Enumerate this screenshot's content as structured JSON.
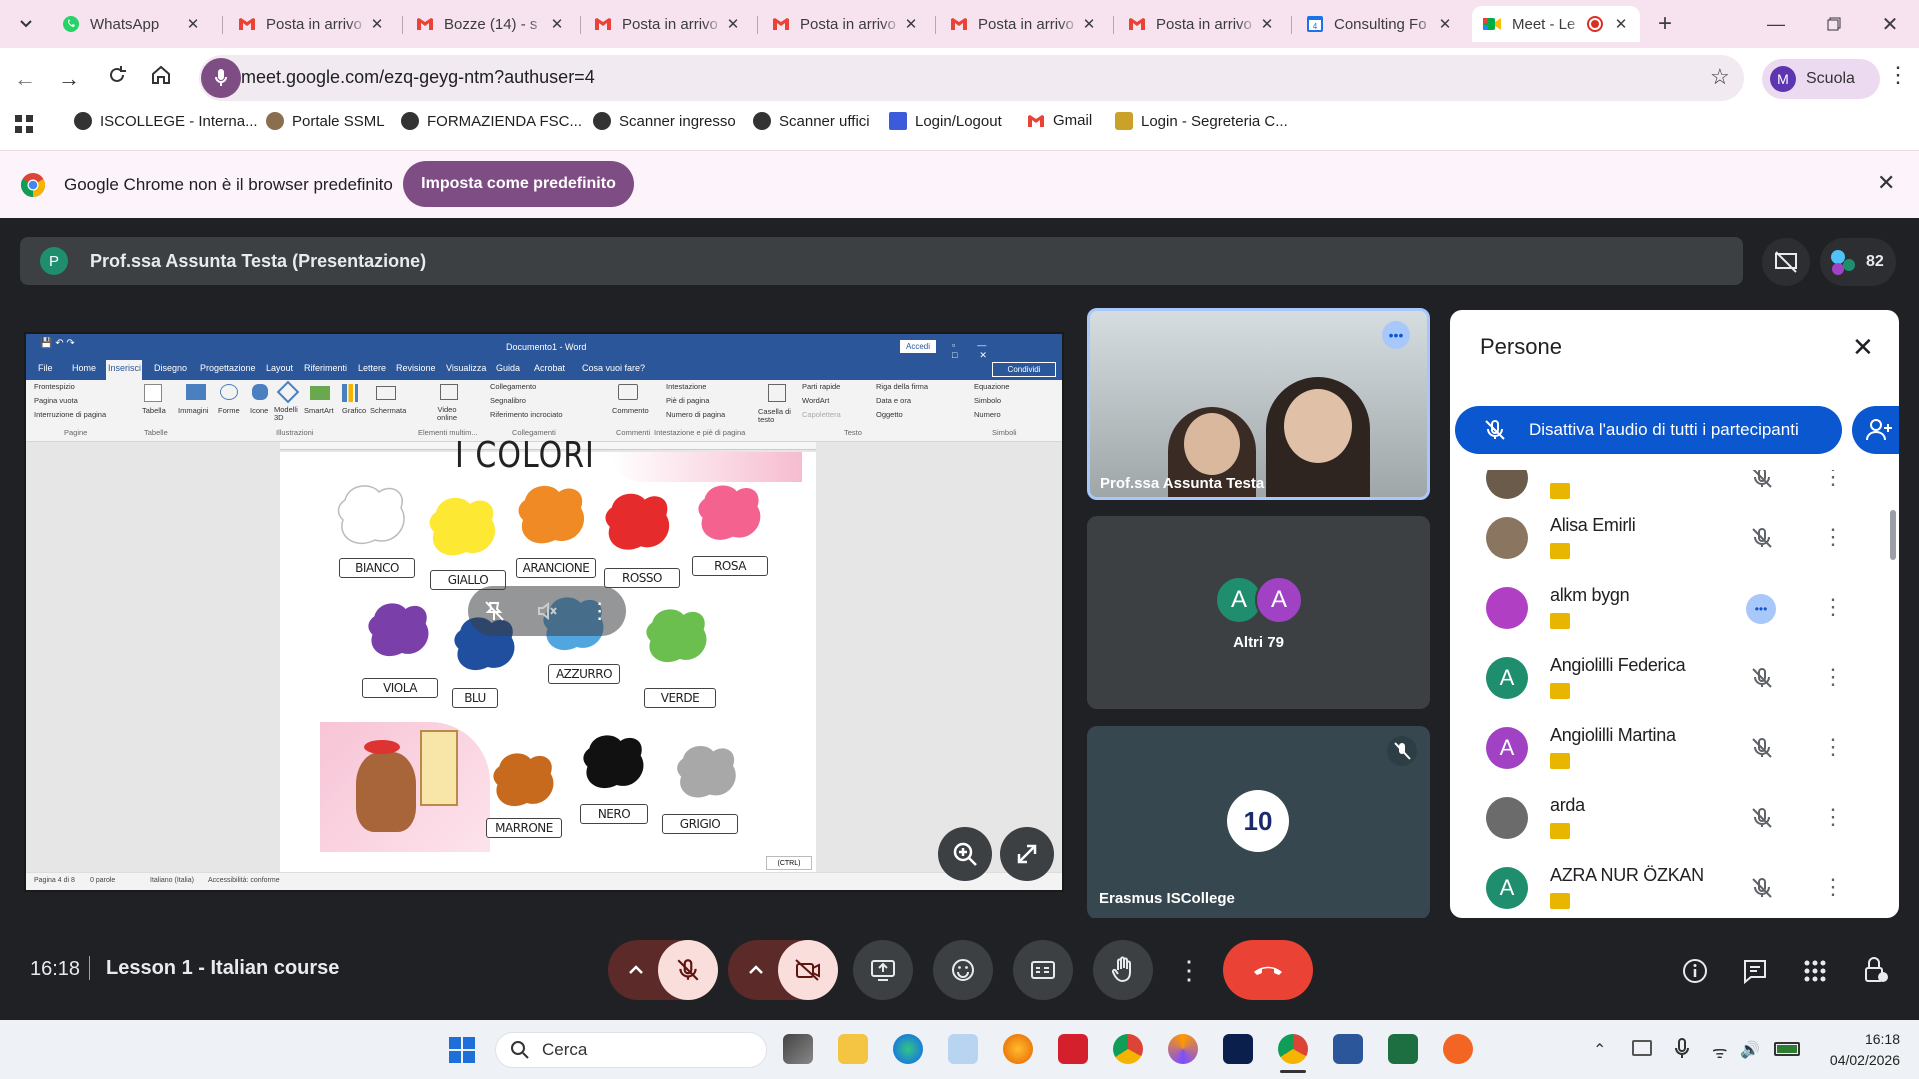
{
  "browser": {
    "tabs": [
      {
        "label": "WhatsApp",
        "icon": "whatsapp-icon"
      },
      {
        "label": "Posta in arrivo",
        "icon": "gmail-icon"
      },
      {
        "label": "Bozze (14) - s",
        "icon": "gmail-icon"
      },
      {
        "label": "Posta in arrivo",
        "icon": "gmail-icon"
      },
      {
        "label": "Posta in arrivo",
        "icon": "gmail-icon"
      },
      {
        "label": "Posta in arrivo",
        "icon": "gmail-icon"
      },
      {
        "label": "Posta in arrivo",
        "icon": "gmail-icon"
      },
      {
        "label": "Consulting Fo",
        "icon": "calendar-icon"
      },
      {
        "label": "Meet - Le",
        "icon": "meet-icon",
        "active": true
      }
    ],
    "url": "meet.google.com/ezq-geyg-ntm?authuser=4",
    "profile_name": "Scuola",
    "profile_initial": "M",
    "bookmarks": [
      "ISCOLLEGE - Interna...",
      "Portale SSML",
      "FORMAZIENDA FSC...",
      "Scanner ingresso",
      "Scanner uffici",
      "Login/Logout",
      "Gmail",
      "Login - Segreteria C..."
    ],
    "infobar_text": "Google Chrome non è il browser predefinito",
    "infobar_button": "Imposta come predefinito"
  },
  "meet": {
    "presenter_initial": "P",
    "presenter_label": "Prof.ssa Assunta Testa (Presentazione)",
    "participant_count": "82",
    "time": "16:18",
    "meeting_title": "Lesson 1 - Italian course",
    "tiles": {
      "main_name": "Prof.ssa Assunta Testa",
      "others_label": "Altri 79",
      "others_initials": [
        "A",
        "A"
      ],
      "erasmus_name": "Erasmus ISCollege"
    },
    "panel": {
      "title": "Persone",
      "mute_all": "Disattiva l'audio di tutti i partecipanti",
      "people": [
        {
          "name": "",
          "initial": "",
          "color": "#6b5b4b"
        },
        {
          "name": "Alisa Emirli",
          "initial": "",
          "color": "#8a7560"
        },
        {
          "name": "alkm bygn",
          "initial": "",
          "color": "#b03fc4"
        },
        {
          "name": "Angiolilli Federica",
          "initial": "A",
          "color": "#1e8e6e"
        },
        {
          "name": "Angiolilli Martina",
          "initial": "A",
          "color": "#a142c4"
        },
        {
          "name": "arda",
          "initial": "",
          "color": "#6b6b6b"
        },
        {
          "name": "AZRA NUR ÖZKAN",
          "initial": "A",
          "color": "#1e8e6e"
        }
      ]
    }
  },
  "word": {
    "doc_title": "Documento1 - Word",
    "signin": "Accedi",
    "share": "Condividi",
    "tabs": [
      "File",
      "Home",
      "Inserisci",
      "Disegno",
      "Progettazione",
      "Layout",
      "Riferimenti",
      "Lettere",
      "Revisione",
      "Visualizza",
      "Guida",
      "Acrobat",
      "Cosa vuoi fare?"
    ],
    "ribbon_left": [
      "Frontespizio",
      "Pagina vuota",
      "Interruzione di pagina"
    ],
    "ribbon_icons": [
      "Tabella",
      "Immagini",
      "Forme",
      "Icone",
      "Modelli 3D",
      "SmartArt",
      "Grafico",
      "Schermata"
    ],
    "ribbon_online": "Video online",
    "ribbon_links": [
      "Collegamento",
      "Segnalibro",
      "Riferimento incrociato"
    ],
    "ribbon_comment": "Commento",
    "ribbon_header": [
      "Intestazione",
      "Piè di pagina",
      "Numero di pagina"
    ],
    "ribbon_textbox": "Casella di testo",
    "ribbon_text": [
      "Parti rapide",
      "WordArt",
      "Capolettera",
      "Riga della firma",
      "Data e ora",
      "Oggetto"
    ],
    "ribbon_symbols": [
      "Equazione",
      "Simbolo",
      "Numero"
    ],
    "groups": [
      "Pagine",
      "Tabelle",
      "Illustrazioni",
      "Elementi multim...",
      "Collegamenti",
      "Commenti",
      "Intestazione e piè di pagina",
      "Testo",
      "Simboli"
    ],
    "status": [
      "Pagina 4 di 8",
      "0 parole",
      "Italiano (Italia)",
      "Accessibilità: conforme"
    ],
    "page_title": "I COLORI",
    "colors": [
      {
        "label": "BIANCO",
        "color": "#ffffff"
      },
      {
        "label": "GIALLO",
        "color": "#fde934"
      },
      {
        "label": "ARANCIONE",
        "color": "#f08a24"
      },
      {
        "label": "ROSSO",
        "color": "#e52b2b"
      },
      {
        "label": "ROSA",
        "color": "#f4628f"
      },
      {
        "label": "VIOLA",
        "color": "#7a3fa8"
      },
      {
        "label": "BLU",
        "color": "#1f4f9e"
      },
      {
        "label": "AZZURRO",
        "color": "#52a6e0"
      },
      {
        "label": "VERDE",
        "color": "#6bbf4f"
      },
      {
        "label": "MARRONE",
        "color": "#c86a1e"
      },
      {
        "label": "NERO",
        "color": "#111111"
      },
      {
        "label": "GRIGIO",
        "color": "#a8a8a8"
      }
    ],
    "ctrl_badge": "(CTRL)"
  },
  "taskbar": {
    "search_placeholder": "Cerca",
    "time": "16:18",
    "date": "04/02/2026"
  },
  "colors": {
    "accent": "#7d4d83",
    "meet_blue": "#0b57d0",
    "hangup": "#ea4335",
    "muted_btn": "#f9dedc"
  }
}
